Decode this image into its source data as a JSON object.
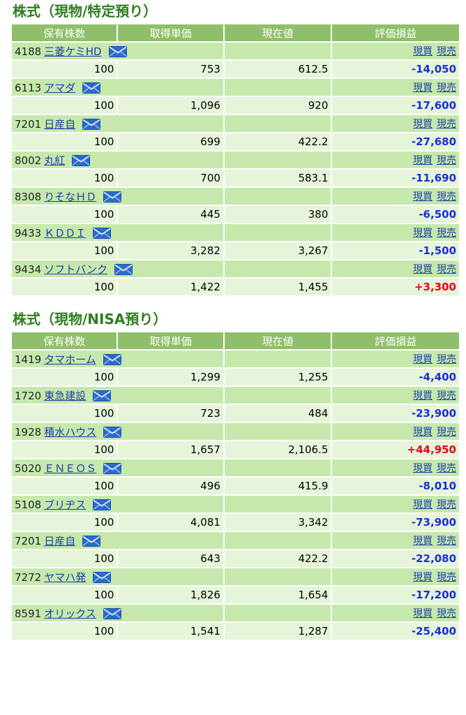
{
  "colors": {
    "title": "#2e7d1f",
    "header_bg": "#8fbf6a",
    "name_row_bg": "#c6e8ad",
    "value_row_bg": "#e6f4da",
    "link": "#1b3fa6",
    "loss": "#1a2fd6",
    "gain": "#e8001a"
  },
  "icons": {
    "mail": "mail-icon"
  },
  "columns": [
    "保有株数",
    "取得単価",
    "現在値",
    "評価損益"
  ],
  "actions": {
    "buy": "現買",
    "sell": "現売"
  },
  "sections": [
    {
      "title": "株式（現物/特定預り）",
      "rows": [
        {
          "code": "4188",
          "name": "三菱ケミHD",
          "shares": "100",
          "cost": "753",
          "price": "612.5",
          "pl": "-14,050",
          "sign": "neg"
        },
        {
          "code": "6113",
          "name": "アマダ",
          "shares": "100",
          "cost": "1,096",
          "price": "920",
          "pl": "-17,600",
          "sign": "neg"
        },
        {
          "code": "7201",
          "name": "日産自",
          "shares": "100",
          "cost": "699",
          "price": "422.2",
          "pl": "-27,680",
          "sign": "neg"
        },
        {
          "code": "8002",
          "name": "丸紅",
          "shares": "100",
          "cost": "700",
          "price": "583.1",
          "pl": "-11,690",
          "sign": "neg"
        },
        {
          "code": "8308",
          "name": "りそなＨＤ",
          "shares": "100",
          "cost": "445",
          "price": "380",
          "pl": "-6,500",
          "sign": "neg"
        },
        {
          "code": "9433",
          "name": "ＫＤＤＩ",
          "shares": "100",
          "cost": "3,282",
          "price": "3,267",
          "pl": "-1,500",
          "sign": "neg"
        },
        {
          "code": "9434",
          "name": "ソフトバンク",
          "shares": "100",
          "cost": "1,422",
          "price": "1,455",
          "pl": "+3,300",
          "sign": "pos"
        }
      ]
    },
    {
      "title": "株式（現物/NISA預り）",
      "rows": [
        {
          "code": "1419",
          "name": "タマホーム",
          "shares": "100",
          "cost": "1,299",
          "price": "1,255",
          "pl": "-4,400",
          "sign": "neg"
        },
        {
          "code": "1720",
          "name": "東急建設",
          "shares": "100",
          "cost": "723",
          "price": "484",
          "pl": "-23,900",
          "sign": "neg"
        },
        {
          "code": "1928",
          "name": "積水ハウス",
          "shares": "100",
          "cost": "1,657",
          "price": "2,106.5",
          "pl": "+44,950",
          "sign": "pos"
        },
        {
          "code": "5020",
          "name": "ＥＮＥＯＳ",
          "shares": "100",
          "cost": "496",
          "price": "415.9",
          "pl": "-8,010",
          "sign": "neg"
        },
        {
          "code": "5108",
          "name": "ブリヂス",
          "shares": "100",
          "cost": "4,081",
          "price": "3,342",
          "pl": "-73,900",
          "sign": "neg"
        },
        {
          "code": "7201",
          "name": "日産自",
          "shares": "100",
          "cost": "643",
          "price": "422.2",
          "pl": "-22,080",
          "sign": "neg"
        },
        {
          "code": "7272",
          "name": "ヤマハ発",
          "shares": "100",
          "cost": "1,826",
          "price": "1,654",
          "pl": "-17,200",
          "sign": "neg"
        },
        {
          "code": "8591",
          "name": "オリックス",
          "shares": "100",
          "cost": "1,541",
          "price": "1,287",
          "pl": "-25,400",
          "sign": "neg"
        }
      ]
    }
  ]
}
